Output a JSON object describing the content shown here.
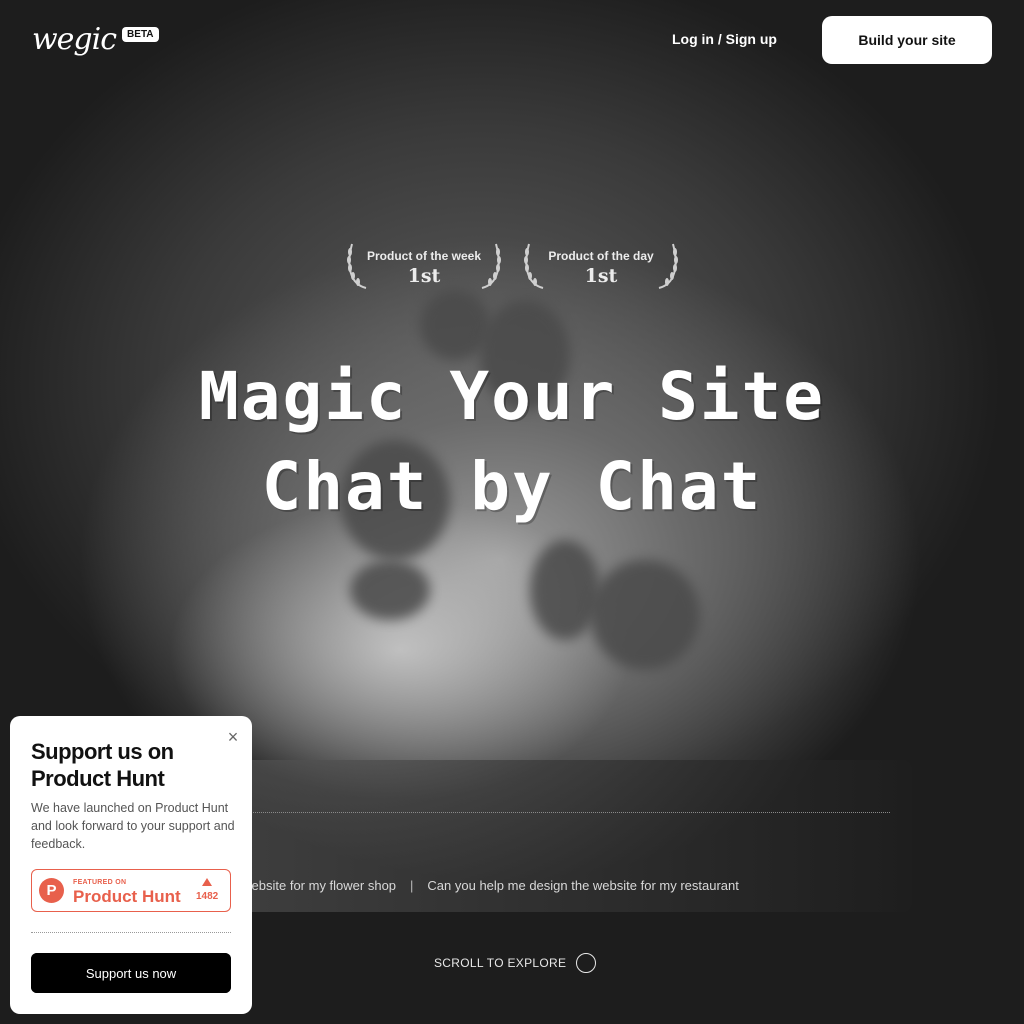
{
  "header": {
    "logo_text": "wegic",
    "beta_label": "BETA",
    "login_label": "Log in / Sign up",
    "build_label": "Build your site"
  },
  "awards": [
    {
      "title": "Product of the week",
      "rank": "1st"
    },
    {
      "title": "Product of the day",
      "rank": "1st"
    }
  ],
  "hero": {
    "line1": "Magic Your Site",
    "line2": "Chat by Chat"
  },
  "chat": {
    "suggestions": [
      "I want a website for my flower shop",
      "Can you help me design the website for my restaurant"
    ],
    "separator": "|"
  },
  "scroll": {
    "label": "SCROLL TO EXPLORE"
  },
  "support_card": {
    "title": "Support us on Product Hunt",
    "description": "We have launched on Product Hunt and look forward to your support and feedback.",
    "ph_featured": "FEATURED ON",
    "ph_name": "Product Hunt",
    "ph_count": "1482",
    "ph_logo_letter": "P",
    "button_label": "Support us now",
    "close_icon": "×",
    "accent_color": "#e8604c"
  }
}
